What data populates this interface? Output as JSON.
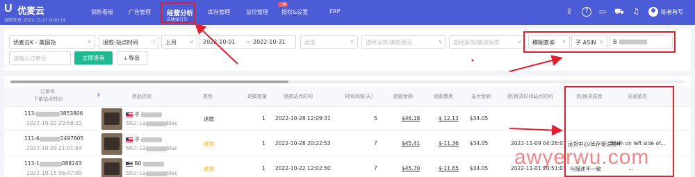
{
  "topnav": {
    "logo_mark": "U",
    "logo_text": "优麦云",
    "logo_sub": "当前时间: 2022-11-27 Oct0:19",
    "items": [
      "销售看板",
      "广告管理",
      "库存管理",
      "监控管理",
      "授权&设置",
      "ERP"
    ],
    "active_main": "经营分析",
    "active_sub": "店铺/单订节",
    "new_badge": "上新",
    "user_name": "陈者有写",
    "icons": [
      "upload-icon",
      "help-icon",
      "message-icon",
      "cart-icon",
      "bell-icon"
    ]
  },
  "filters": {
    "store": "优麦云K - 美国站",
    "date_type": "退款-站点时间",
    "period": "上月",
    "date_start": "2022-10-01",
    "date_separator": "→",
    "date_end": "2022-10-31",
    "type_placeholder": "类型",
    "reason_placeholder": "选择退货/换货原因",
    "status_placeholder": "选择退货/换货状态",
    "query_mode": "模糊查询",
    "asin_type": "子 ASIN",
    "asin_value": "B",
    "order_placeholder": "请输入订单号",
    "search_button": "立即查询",
    "export_button": "导出",
    "export_icon": "download-icon"
  },
  "table": {
    "headers": {
      "order_no": "订单号",
      "order_time": "下单站点时间",
      "product": "商品信息",
      "type": "类型",
      "qty": "退款数量",
      "refund_time": "退款站点时间",
      "interval": "时间间隔(天)",
      "refund_amount": "退款金额",
      "refund_fee": "退款费用",
      "pay_amount": "支付金额",
      "return_time": "退/换货时间站点时间",
      "reason": "退/换货原因",
      "buyer_note": "买家留言"
    },
    "rows": [
      {
        "order_no": "113-",
        "order_no_tail": "3853806",
        "order_time": "2022-10-22 20:58:22",
        "product_title": "子",
        "product_sku": "SKU: La",
        "product_sku_tail": "blac",
        "type": "退款",
        "qty": "1",
        "refund_time": "2022-10-28 12:09:31",
        "interval": "5",
        "refund_amount": "$46.18",
        "refund_fee": "$ 12.13",
        "pay_amount": "$34.05",
        "return_time": "",
        "reason": "",
        "buyer_note": ""
      },
      {
        "order_no": "111-6",
        "order_no_tail": "1497805",
        "order_time": "2022-10-20 21:01:54",
        "product_title": "子",
        "product_sku": "SKU: La",
        "product_sku_tail": "blac",
        "type": "退货",
        "qty": "1",
        "refund_time": "2022-10-28 20:22:53",
        "interval": "7",
        "refund_amount": "$45.41",
        "refund_fee": "$-11.36",
        "pay_amount": "$34.05",
        "return_time": "2022-11-09 04:26:01",
        "reason": "运货中心/库存错误损坏",
        "buyer_note": "Stain on left side of..."
      },
      {
        "order_no": "113-1",
        "order_no_tail": "088243",
        "order_time": "2022-10-15 06:47:00",
        "product_title": "B0",
        "product_sku": "SKU: La",
        "product_sku_tail": "blac",
        "type": "退货",
        "qty": "1",
        "refund_time": "2022-10-22 12:02:50",
        "interval": "7",
        "refund_amount": "$45.70",
        "refund_fee": "$-11.65",
        "pay_amount": "$34.05",
        "return_time": "2022-11-01 20:51:07",
        "reason": "与描述不一致",
        "buyer_note": "..."
      }
    ]
  },
  "watermark": "awyerwu.com"
}
